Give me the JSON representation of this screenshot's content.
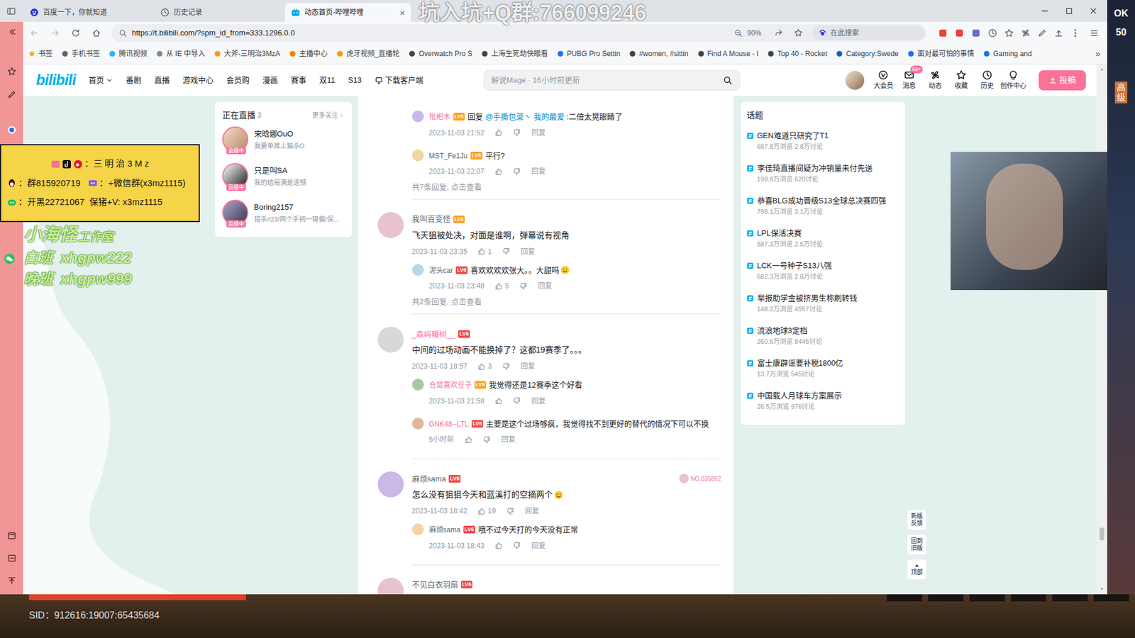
{
  "overlay": {
    "top_banner": "坑入坑+Q群:766099246",
    "promo": {
      "line1": "：三 明 治 3 M z",
      "line2a": "：群815920719",
      "line2b": "：+微信群(x3mz1115)",
      "line3": "：开黑22721067  保猪+V: x3mz1115"
    },
    "studio": {
      "main": "小海怪",
      "sub": "工作室"
    },
    "shifts": [
      {
        "label": "白班",
        "id": "xhgpw222"
      },
      {
        "label": "晚班",
        "id": "xhgpw999"
      }
    ],
    "game_hud": [
      "OK",
      "50",
      "高级"
    ],
    "sid": "SID：912616:19007:65435684"
  },
  "browser": {
    "tabs": [
      {
        "label": "百度一下，你就知道",
        "selected": false
      },
      {
        "label": "历史记录",
        "selected": false
      },
      {
        "label": "动态首页-哔哩哔哩",
        "selected": true
      }
    ],
    "close_glyph": "×",
    "url": "https://t.bilibili.com/?spm_id_from=333.1296.0.0",
    "zoom": "90%",
    "search_engine": "在此搜索",
    "bookmarks": [
      "书签",
      "手机书签",
      "腾讯视频",
      "从 IE 中导入",
      "大斧-三明治3MzA",
      "主播中心",
      "虎牙视频_直播轮",
      "Overwatch Pro S",
      "上海生死劫快眼看",
      "PUBG Pro Settin",
      "#women, #sittin",
      "Find A Mouse - I",
      "Top 40 - Rocket",
      "Category:Swede",
      "面对最可怕的事情",
      "Gaming and"
    ],
    "more_bookmarks": "»"
  },
  "bilibili": {
    "logo": "bilibili",
    "nav": [
      "首页",
      "番剧",
      "直播",
      "游戏中心",
      "会员购",
      "漫画",
      "赛事",
      "双11",
      "S13",
      "下载客户端"
    ],
    "search_placeholder": "解说Mage · 16小时前更新",
    "header_icons": [
      {
        "label": "大会员"
      },
      {
        "label": "消息",
        "badge": "99+"
      },
      {
        "label": "动态"
      },
      {
        "label": "收藏"
      },
      {
        "label": "历史"
      },
      {
        "label": "创作中心"
      }
    ],
    "upload": "投稿",
    "live": {
      "title": "正在直播",
      "count": "3",
      "more": "更多关注",
      "items": [
        {
          "name": "宋晗娜OuO",
          "desc": "我要单推上猫杀O",
          "badge": "直播中"
        },
        {
          "name": "只是叫SA",
          "desc": "我的结局满是遗憾",
          "badge": "直播中"
        },
        {
          "name": "Boring2157",
          "desc": "猎杀#23/两个手柄一键偏/保...",
          "badge": "直播中"
        }
      ]
    },
    "threads": [
      {
        "replies": [
          {
            "user": "枇杷木",
            "level": "LV5",
            "name_color": "#fb7299",
            "prefix": "回复 ",
            "mention": "@手撕包菜丶 我的最爱",
            "text": " :二倍太晃眼睛了",
            "time": "2023-11-03 21:52",
            "reply_label": "回复"
          },
          {
            "user": "MST_Fe1Ju",
            "level": "LV5",
            "name_color": "#61666d",
            "text": "平行?",
            "time": "2023-11-03 22:07",
            "reply_label": "回复"
          }
        ],
        "more": "共7条回复, 点击查看"
      },
      {
        "main": {
          "user": "我叫百变怪",
          "level": "LV5",
          "name_color": "#61666d",
          "text": "飞天狙被处决，对面是谁啊，弹幕说有视角",
          "time": "2023-11-03 23:35",
          "likes": "1",
          "reply_label": "回复"
        },
        "replies": [
          {
            "user": "泥头car",
            "level": "LV6",
            "name_color": "#61666d",
            "text": "喜欢欢欢欢张大。。大甜吗",
            "emoji": true,
            "time": "2023-11-03 23:48",
            "likes": "5",
            "reply_label": "回复"
          }
        ],
        "more": "共2条回复, 点击查看"
      },
      {
        "main": {
          "user": "_森屿暖树__",
          "level": "LV6",
          "name_color": "#fb7299",
          "text": "中间的过场动画不能换掉了？这都19赛季了。。。",
          "time": "2023-11-03 18:57",
          "likes": "3",
          "reply_label": "回复"
        },
        "replies": [
          {
            "user": "仓鼠喜欢豆子",
            "level": "LV5",
            "name_color": "#fb7299",
            "text": "我觉得还是12赛季这个好看",
            "time": "2023-11-03 21:58",
            "reply_label": "回复"
          },
          {
            "user": "GNK48--LTL",
            "level": "LV6",
            "name_color": "#fb7299",
            "text": "主要是这个过场够疯，我觉得找不到更好的替代的情况下可以不换",
            "time": "5小时前",
            "reply_label": "回复"
          }
        ]
      },
      {
        "main": {
          "user": "麻烦sama",
          "level": "LV6",
          "name_color": "#61666d",
          "text": "怎么没有狙狙今天和蓝溪打的空摘两个",
          "emoji": true,
          "time": "2023-11-03 18:42",
          "likes": "19",
          "reply_label": "回复",
          "fan_badge": "NO.035892"
        },
        "replies": [
          {
            "user": "麻烦sama",
            "level": "LV6",
            "name_color": "#61666d",
            "text": "哦不过今天打的今天没有正常",
            "time": "2023-11-03 18:43",
            "reply_label": "回复"
          }
        ]
      },
      {
        "main": {
          "user": "不见白衣羽扇",
          "level": "LV6",
          "name_color": "#61666d"
        },
        "replies": []
      }
    ],
    "topics": {
      "title": "话题",
      "items": [
        {
          "title": "GEN难道只研究了T1",
          "stats": "687.8万浏览 2.8万讨论"
        },
        {
          "title": "李佳琦直播间疑为冲销量未付先送",
          "stats": "198.8万浏览 620讨论"
        },
        {
          "title": "恭喜BLG成功晋级S13全球总决赛四强",
          "stats": "798.1万浏览 3.1万讨论"
        },
        {
          "title": "LPL保活决赛",
          "stats": "587.3万浏览 2.5万讨论"
        },
        {
          "title": "LCK一号种子S13八强",
          "stats": "682.3万浏览 2.8万讨论"
        },
        {
          "title": "举报助学金被挤男生称刷转钱",
          "stats": "148.2万浏览 4557讨论"
        },
        {
          "title": "流浪地球3定档",
          "stats": "260.6万浏览 8445讨论"
        },
        {
          "title": "富士康辟谣要补税1800亿",
          "stats": "13.7万浏览 545讨论"
        },
        {
          "title": "中国载人月球车方案展示",
          "stats": "26.5万浏览 976讨论"
        }
      ]
    },
    "float_buttons": [
      {
        "label": "新版反馈"
      },
      {
        "label": "回到旧版"
      },
      {
        "label": "顶部"
      }
    ]
  }
}
